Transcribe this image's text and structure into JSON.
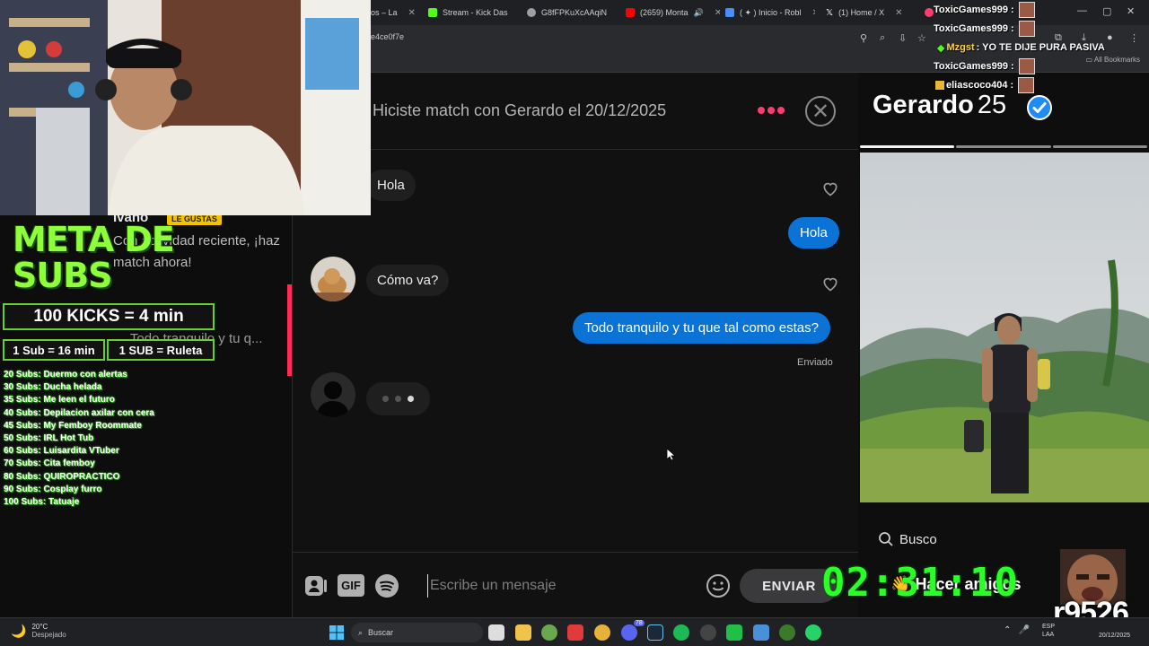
{
  "browser": {
    "tabs": [
      {
        "label": "os – La",
        "color": "#c43c3c"
      },
      {
        "label": "Stream - Kick Das",
        "color": "#53fc18"
      },
      {
        "label": "G8fFPKuXcAAqiN",
        "color": "#9aa0a6"
      },
      {
        "label": "(2659) Monta",
        "color": "#ff0000"
      },
      {
        "label": "( ✦ ) Inicio - Robl",
        "color": "#4a8cff"
      },
      {
        "label": "(1) Home / X",
        "color": "#ffffff"
      }
    ],
    "url": "e4ce0f7e",
    "bookmarks_label": "All Bookmarks"
  },
  "left_panel": {
    "name": "Ivano",
    "badge": "LE GUSTAS",
    "activity_text": "Con actividad reciente, ¡haz match ahora!",
    "last_message": "← Todo tranquilo y tu q..."
  },
  "chat": {
    "match_line": "Hiciste match con Gerardo el 20/12/2025",
    "close_label": "✕",
    "messages": [
      {
        "dir": "in",
        "text": "Hola"
      },
      {
        "dir": "out",
        "text": "Hola"
      },
      {
        "dir": "in",
        "text": "Cómo va?"
      },
      {
        "dir": "out",
        "text": "Todo tranquilo y tu que tal como estas?"
      }
    ],
    "sent_label": "Enviado",
    "composer": {
      "gif_label": "GIF",
      "placeholder": "Escribe un mensaje",
      "send_label": "ENVIAR"
    }
  },
  "profile": {
    "name": "Gerardo",
    "age": "25",
    "search_label": "Busco",
    "friends_label": "Hacer amigos",
    "photo_count": 3,
    "current_photo": 1
  },
  "overlay": {
    "meta_title": "META DE SUBS",
    "kicks_rule": "100 KICKS = 4 min",
    "sub_rule": "1 Sub = 16 min",
    "sub_roulette": "1 SUB = Ruleta",
    "goals": [
      "20 Subs: Duermo con alertas",
      "30 Subs: Ducha helada",
      "35 Subs: Me leen el futuro",
      "40 Subs: Depilacion axilar con cera",
      "45 Subs: My Femboy Roommate",
      "50 Subs: IRL Hot Tub",
      "60 Subs: Luisardita VTuber",
      "70 Subs: Cita femboy",
      "80 Subs: QUIROPRACTICO",
      "90 Subs: Cosplay furro",
      "100 Subs: Tatuaje"
    ],
    "stream_chat": [
      {
        "user": "ToxicGames999 :",
        "msg": "",
        "color": "#ffffff",
        "icon": ""
      },
      {
        "user": "ToxicGames999 :",
        "msg": "",
        "color": "#ffffff",
        "icon": ""
      },
      {
        "user": "Mzgst",
        "msg": " : YO TE DIJE PURA PASIVA",
        "color": "#ffd23c",
        "icon": "leaf"
      },
      {
        "user": "ToxicGames999 :",
        "msg": "",
        "color": "#ffffff",
        "icon": ""
      },
      {
        "user": "eliascoco404 :",
        "msg": "",
        "color": "#ffffff",
        "icon": "badge"
      }
    ],
    "timer": "02:31:10",
    "code": "r9526"
  },
  "taskbar": {
    "temp": "20°C",
    "weather": "Despejado",
    "search_label": "Buscar",
    "lang1": "ESP",
    "lang2": "LAA",
    "date": "20/12/2025",
    "badge_count": "78"
  },
  "colors": {
    "brand": "#fe3c72",
    "bubble_out": "#0b72d6",
    "overlay_green": "#8fff3b",
    "timer_green": "#2aff27"
  }
}
